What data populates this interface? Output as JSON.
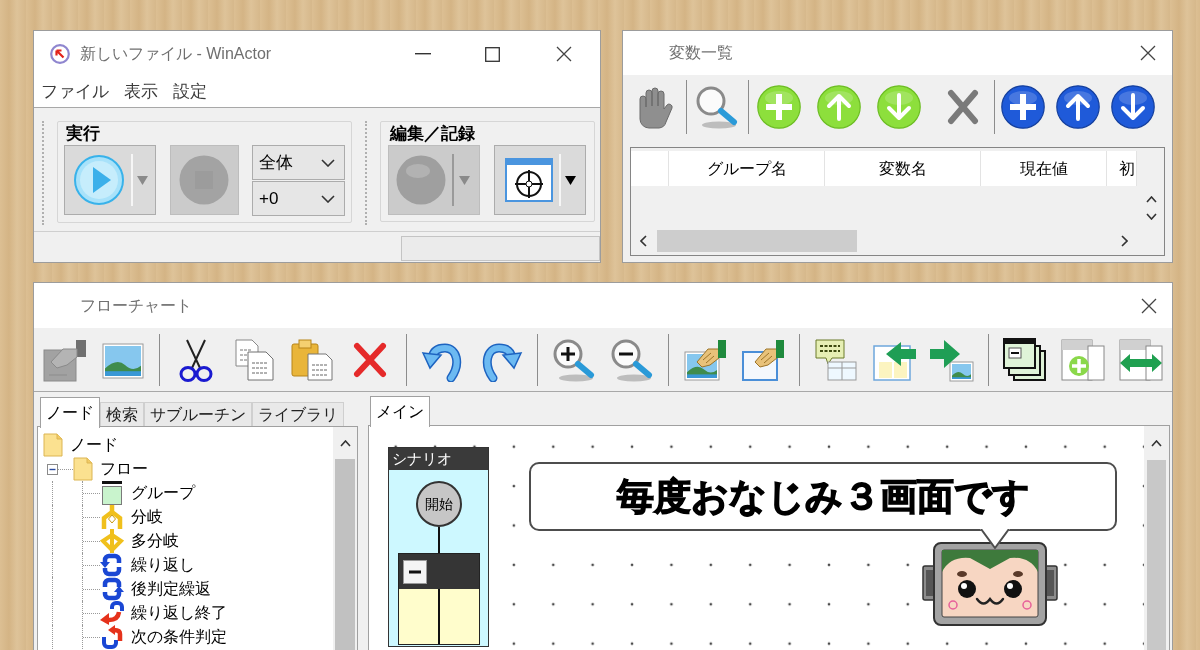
{
  "main_window": {
    "title": "新しいファイル - WinActor",
    "menu": [
      "ファイル",
      "表示",
      "設定"
    ],
    "run_group": {
      "label": "実行",
      "dropdowns": [
        {
          "value": "全体"
        },
        {
          "value": "+0"
        }
      ]
    },
    "edit_group": {
      "label": "編集／記録"
    }
  },
  "variables_window": {
    "title": "変数一覧",
    "columns": [
      "グループ名",
      "変数名",
      "現在値",
      "初"
    ]
  },
  "flowchart_window": {
    "title": "フローチャート",
    "panel_tabs": [
      {
        "label": "ノード",
        "selected": true
      },
      {
        "label": "検索",
        "selected": false
      },
      {
        "label": "サブルーチン",
        "selected": false
      },
      {
        "label": "ライブラリ",
        "selected": false
      }
    ],
    "tree": [
      {
        "label": "ノード",
        "kind": "folder",
        "children": [
          {
            "label": "フロー",
            "kind": "folder",
            "expanded": true,
            "children": [
              {
                "label": "グループ",
                "kind": "group"
              },
              {
                "label": "分岐",
                "kind": "branch"
              },
              {
                "label": "多分岐",
                "kind": "multi_branch"
              },
              {
                "label": "繰り返し",
                "kind": "loop"
              },
              {
                "label": "後判定繰返",
                "kind": "post_loop"
              },
              {
                "label": "繰り返し終了",
                "kind": "loop_end"
              },
              {
                "label": "次の条件判定",
                "kind": "next_condition"
              }
            ]
          }
        ]
      }
    ],
    "canvas_tabs": [
      {
        "label": "メイン",
        "selected": true
      }
    ],
    "lane": {
      "title": "シナリオ",
      "start_node": "開始"
    }
  },
  "callout": {
    "text": "毎度おなじみ３画面です"
  }
}
